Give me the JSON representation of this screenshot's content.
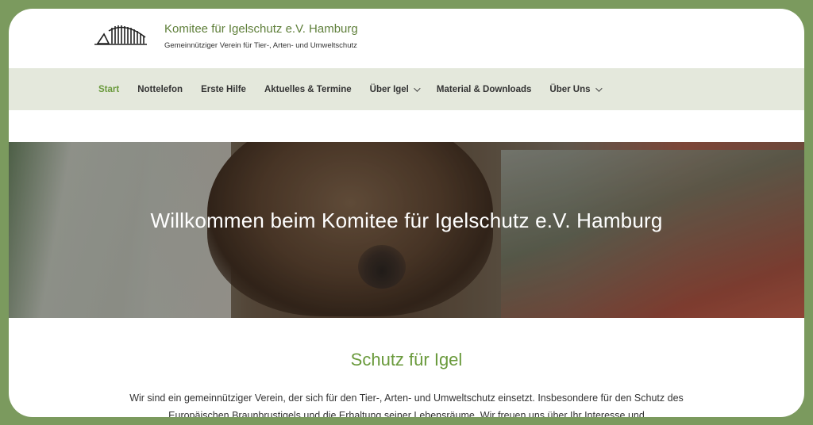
{
  "header": {
    "site_title": "Komitee für Igelschutz e.V. Hamburg",
    "tagline": "Gemeinnütziger Verein für Tier-, Arten- und Umweltschutz",
    "logo_icon": "hedgehog-logo-icon"
  },
  "nav": {
    "items": [
      {
        "label": "Start",
        "active": true
      },
      {
        "label": "Nottelefon"
      },
      {
        "label": "Erste Hilfe"
      },
      {
        "label": "Aktuelles & Termine"
      },
      {
        "label": "Über Igel",
        "dropdown": true
      },
      {
        "label": "Material & Downloads"
      },
      {
        "label": "Über Uns",
        "dropdown": true
      }
    ]
  },
  "hero": {
    "title": "Willkommen beim Komitee für Igelschutz e.V. Hamburg"
  },
  "main": {
    "heading": "Schutz für Igel",
    "intro": "Wir sind ein gemeinnütziger Verein, der sich für den Tier-, Arten- und Umweltschutz einsetzt. Insbesondere für den Schutz des Europäischen Braunbrustigels und die Erhaltung seiner Lebensräume. Wir freuen uns über Ihr Interesse und"
  },
  "colors": {
    "background": "#7b9a5e",
    "accent": "#6a9a3c",
    "nav_bg": "#e4e8dc"
  }
}
